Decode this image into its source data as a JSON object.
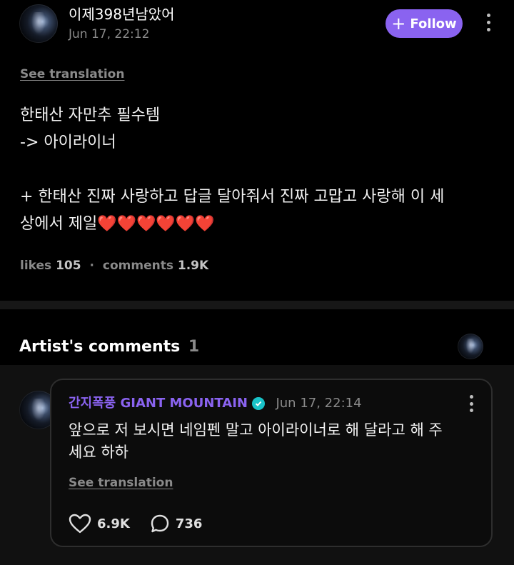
{
  "post": {
    "author_name": "이제398년남았어",
    "timestamp": "Jun 17, 22:12",
    "follow_label": "Follow",
    "see_translation": "See translation",
    "body_lines": [
      "한태산 자만추 필수템",
      "-> 아이라이너",
      "",
      "+ 한태산 진짜 사랑하고 답글 달아줘서 진짜 고맙고 사랑해 이 세",
      "상에서 제일❤️❤️❤️❤️❤️❤️"
    ],
    "likes_label": "likes",
    "likes_count": "105",
    "separator": "·",
    "comments_label": "comments",
    "comments_count": "1.9K"
  },
  "artist_section": {
    "title": "Artist's comments",
    "count": "1"
  },
  "artist_comment": {
    "author": "간지폭풍 GIANT MOUNTAIN",
    "timestamp": "Jun 17, 22:14",
    "text_lines": [
      "앞으로 저 보시면 네임펜 말고 아이라이너로 해 달라고 해 주",
      "세요 하하"
    ],
    "see_translation": "See translation",
    "likes": "6.9K",
    "replies": "736"
  },
  "colors": {
    "follow_button": "#8a63f0",
    "artist_name": "#8a63f0",
    "verified_badge": "#19c3c9"
  },
  "icons": [
    "plus-icon",
    "more-vertical-icon",
    "verified-badge-icon",
    "heart-icon",
    "comment-icon"
  ]
}
